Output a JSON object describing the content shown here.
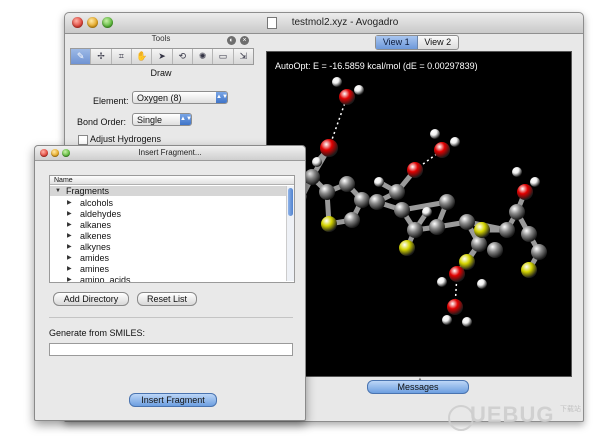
{
  "main_window": {
    "title": "testmol2.xyz - Avogadro"
  },
  "tools_panel": {
    "title": "Tools",
    "toolbar": [
      {
        "icon": "draw-pencil-icon",
        "glyph": "✎"
      },
      {
        "icon": "navigate-icon",
        "glyph": "✢"
      },
      {
        "icon": "bond-centric-icon",
        "glyph": "⌗"
      },
      {
        "icon": "manipulate-icon",
        "glyph": "✋"
      },
      {
        "icon": "select-arrow-icon",
        "glyph": "➤"
      },
      {
        "icon": "auto-rotate-icon",
        "glyph": "⟲"
      },
      {
        "icon": "auto-optimize-icon",
        "glyph": "✺"
      },
      {
        "icon": "measure-icon",
        "glyph": "▭"
      },
      {
        "icon": "align-icon",
        "glyph": "⇲"
      }
    ],
    "mode_label": "Draw",
    "element_label": "Element:",
    "element_value": "Oxygen (8)",
    "bond_order_label": "Bond Order:",
    "bond_order_value": "Single",
    "adjust_hydrogens_label": "Adjust Hydrogens"
  },
  "viewer": {
    "tabs": [
      {
        "label": "View 1",
        "active": true
      },
      {
        "label": "View 2",
        "active": false
      }
    ],
    "autoopt_text": "AutoOpt: E = -16.5859 kcal/mol (dE = 0.00297839)",
    "messages_label": "Messages"
  },
  "insert_fragment": {
    "title": "Insert Fragment...",
    "column_header": "Name",
    "root_label": "Fragments",
    "items": [
      "alcohols",
      "aldehydes",
      "alkanes",
      "alkenes",
      "alkynes",
      "amides",
      "amines",
      "amino_acids"
    ],
    "add_directory_label": "Add Directory",
    "reset_list_label": "Reset List",
    "smiles_label": "Generate from SMILES:",
    "smiles_value": "",
    "insert_button_label": "Insert Fragment"
  },
  "watermark": {
    "text": "UEBUG",
    "small": "下载站"
  },
  "colors": {
    "accent_blue": "#6d9fe0",
    "oxygen": "#e00000",
    "sulfur": "#d4d400",
    "carbon": "#8a8a8a",
    "hydrogen": "#f0f0f0"
  }
}
